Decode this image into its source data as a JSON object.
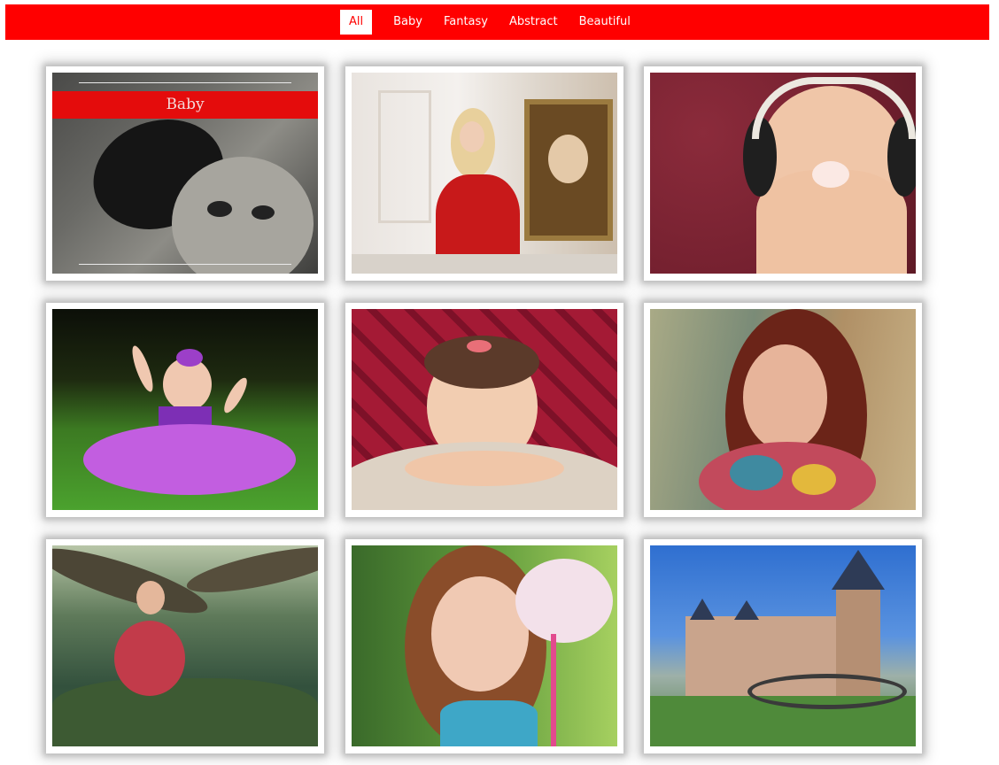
{
  "nav": {
    "items": [
      {
        "label": "All",
        "active": true
      },
      {
        "label": "Baby"
      },
      {
        "label": "Fantasy"
      },
      {
        "label": "Abstract"
      },
      {
        "label": "Beautiful"
      }
    ]
  },
  "gallery": {
    "cards": [
      {
        "subject": "baby with cap (black and white)",
        "caption": "Baby"
      },
      {
        "subject": "girl in red dress beside framed painting"
      },
      {
        "subject": "laughing baby wearing headphones"
      },
      {
        "subject": "baby in purple tutu on grass"
      },
      {
        "subject": "smiling baby on fluffy rug, red patterned wall"
      },
      {
        "subject": "red-haired woman with colorful scarf"
      },
      {
        "subject": "girl in red dress sitting on mossy tree"
      },
      {
        "subject": "freckled girl holding pink cotton candy"
      },
      {
        "subject": "castle with towers under blue sky"
      }
    ]
  }
}
